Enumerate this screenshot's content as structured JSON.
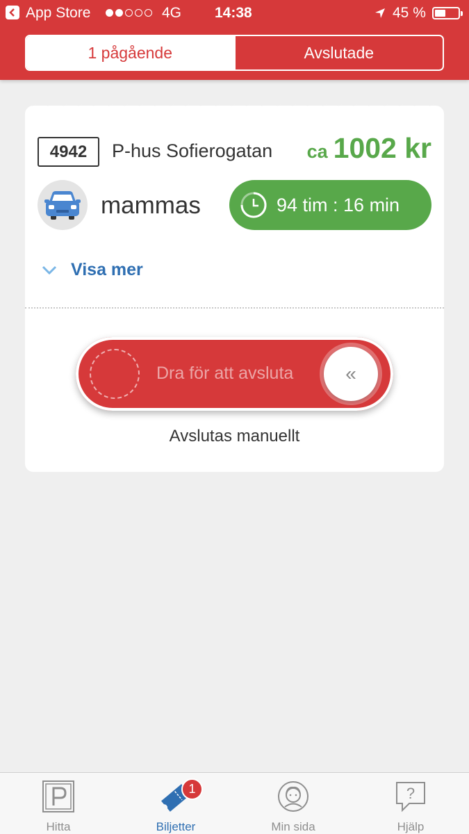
{
  "status_bar": {
    "back_app": "App Store",
    "network": "4G",
    "time": "14:38",
    "battery": "45 %",
    "signal_bars_filled": 2,
    "signal_bars_total": 5
  },
  "segmented_control": {
    "active_tab": "1 pågående",
    "inactive_tab": "Avslutade"
  },
  "ticket": {
    "zone_code": "4942",
    "location": "P-hus Sofierogatan",
    "price_prefix": "ca",
    "price": "1002 kr",
    "vehicle_name": "mammas",
    "elapsed_time": "94 tim : 16 min",
    "show_more": "Visa mer",
    "slider_label": "Dra för att avsluta",
    "end_mode": "Avslutas manuellt"
  },
  "tab_bar": {
    "tabs": [
      {
        "label": "Hitta",
        "icon": "parking-icon"
      },
      {
        "label": "Biljetter",
        "icon": "ticket-icon",
        "badge": "1",
        "active": true
      },
      {
        "label": "Min sida",
        "icon": "profile-icon"
      },
      {
        "label": "Hjälp",
        "icon": "help-icon"
      }
    ]
  },
  "colors": {
    "brand_red": "#d6393a",
    "green": "#58a84a",
    "link_blue": "#2f6fb2"
  }
}
